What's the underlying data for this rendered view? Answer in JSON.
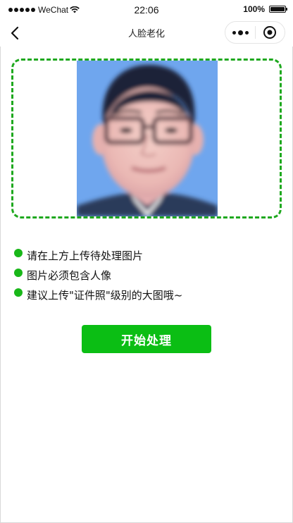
{
  "status_bar": {
    "carrier": "WeChat",
    "time": "22:06",
    "battery_percent": "100%",
    "battery_level": 1.0
  },
  "nav": {
    "title": "人脸老化",
    "back_icon": "chevron-left-icon",
    "more_icon": "more-dots-icon",
    "close_icon": "target-circle-icon"
  },
  "upload": {
    "border_color": "#1ea81e",
    "photo_description_icon": "face-photo"
  },
  "instructions": [
    {
      "text": "请在上方上传待处理图片"
    },
    {
      "text": "图片必须包含人像"
    },
    {
      "text": "建议上传\"证件照\"级别的大图哦~"
    }
  ],
  "actions": {
    "start_label": "开始处理",
    "start_color": "#0bbe14"
  },
  "colors": {
    "accent": "#19b719"
  }
}
